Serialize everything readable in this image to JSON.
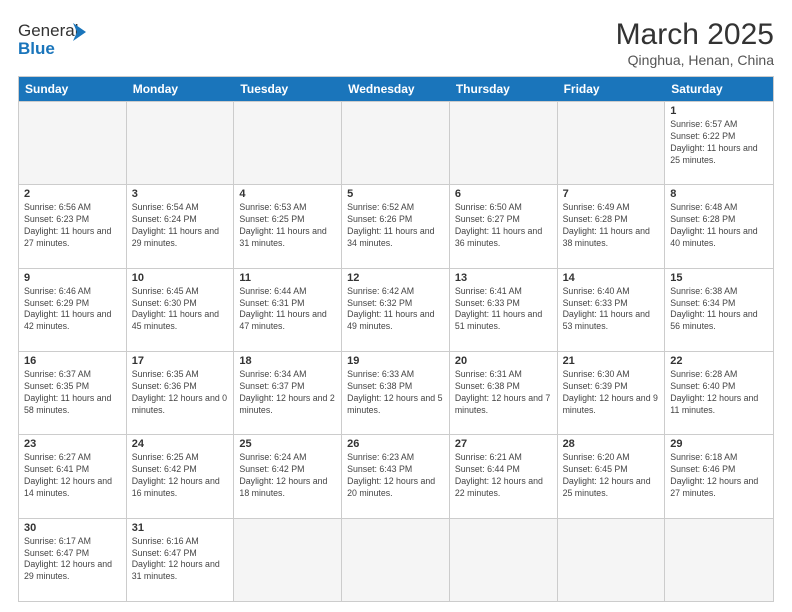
{
  "logo": {
    "text_general": "General",
    "text_blue": "Blue"
  },
  "title": {
    "month_year": "March 2025",
    "location": "Qinghua, Henan, China"
  },
  "header_days": [
    "Sunday",
    "Monday",
    "Tuesday",
    "Wednesday",
    "Thursday",
    "Friday",
    "Saturday"
  ],
  "weeks": [
    [
      {
        "day": "",
        "info": ""
      },
      {
        "day": "",
        "info": ""
      },
      {
        "day": "",
        "info": ""
      },
      {
        "day": "",
        "info": ""
      },
      {
        "day": "",
        "info": ""
      },
      {
        "day": "",
        "info": ""
      },
      {
        "day": "1",
        "info": "Sunrise: 6:57 AM\nSunset: 6:22 PM\nDaylight: 11 hours and 25 minutes."
      }
    ],
    [
      {
        "day": "2",
        "info": "Sunrise: 6:56 AM\nSunset: 6:23 PM\nDaylight: 11 hours and 27 minutes."
      },
      {
        "day": "3",
        "info": "Sunrise: 6:54 AM\nSunset: 6:24 PM\nDaylight: 11 hours and 29 minutes."
      },
      {
        "day": "4",
        "info": "Sunrise: 6:53 AM\nSunset: 6:25 PM\nDaylight: 11 hours and 31 minutes."
      },
      {
        "day": "5",
        "info": "Sunrise: 6:52 AM\nSunset: 6:26 PM\nDaylight: 11 hours and 34 minutes."
      },
      {
        "day": "6",
        "info": "Sunrise: 6:50 AM\nSunset: 6:27 PM\nDaylight: 11 hours and 36 minutes."
      },
      {
        "day": "7",
        "info": "Sunrise: 6:49 AM\nSunset: 6:28 PM\nDaylight: 11 hours and 38 minutes."
      },
      {
        "day": "8",
        "info": "Sunrise: 6:48 AM\nSunset: 6:28 PM\nDaylight: 11 hours and 40 minutes."
      }
    ],
    [
      {
        "day": "9",
        "info": "Sunrise: 6:46 AM\nSunset: 6:29 PM\nDaylight: 11 hours and 42 minutes."
      },
      {
        "day": "10",
        "info": "Sunrise: 6:45 AM\nSunset: 6:30 PM\nDaylight: 11 hours and 45 minutes."
      },
      {
        "day": "11",
        "info": "Sunrise: 6:44 AM\nSunset: 6:31 PM\nDaylight: 11 hours and 47 minutes."
      },
      {
        "day": "12",
        "info": "Sunrise: 6:42 AM\nSunset: 6:32 PM\nDaylight: 11 hours and 49 minutes."
      },
      {
        "day": "13",
        "info": "Sunrise: 6:41 AM\nSunset: 6:33 PM\nDaylight: 11 hours and 51 minutes."
      },
      {
        "day": "14",
        "info": "Sunrise: 6:40 AM\nSunset: 6:33 PM\nDaylight: 11 hours and 53 minutes."
      },
      {
        "day": "15",
        "info": "Sunrise: 6:38 AM\nSunset: 6:34 PM\nDaylight: 11 hours and 56 minutes."
      }
    ],
    [
      {
        "day": "16",
        "info": "Sunrise: 6:37 AM\nSunset: 6:35 PM\nDaylight: 11 hours and 58 minutes."
      },
      {
        "day": "17",
        "info": "Sunrise: 6:35 AM\nSunset: 6:36 PM\nDaylight: 12 hours and 0 minutes."
      },
      {
        "day": "18",
        "info": "Sunrise: 6:34 AM\nSunset: 6:37 PM\nDaylight: 12 hours and 2 minutes."
      },
      {
        "day": "19",
        "info": "Sunrise: 6:33 AM\nSunset: 6:38 PM\nDaylight: 12 hours and 5 minutes."
      },
      {
        "day": "20",
        "info": "Sunrise: 6:31 AM\nSunset: 6:38 PM\nDaylight: 12 hours and 7 minutes."
      },
      {
        "day": "21",
        "info": "Sunrise: 6:30 AM\nSunset: 6:39 PM\nDaylight: 12 hours and 9 minutes."
      },
      {
        "day": "22",
        "info": "Sunrise: 6:28 AM\nSunset: 6:40 PM\nDaylight: 12 hours and 11 minutes."
      }
    ],
    [
      {
        "day": "23",
        "info": "Sunrise: 6:27 AM\nSunset: 6:41 PM\nDaylight: 12 hours and 14 minutes."
      },
      {
        "day": "24",
        "info": "Sunrise: 6:25 AM\nSunset: 6:42 PM\nDaylight: 12 hours and 16 minutes."
      },
      {
        "day": "25",
        "info": "Sunrise: 6:24 AM\nSunset: 6:42 PM\nDaylight: 12 hours and 18 minutes."
      },
      {
        "day": "26",
        "info": "Sunrise: 6:23 AM\nSunset: 6:43 PM\nDaylight: 12 hours and 20 minutes."
      },
      {
        "day": "27",
        "info": "Sunrise: 6:21 AM\nSunset: 6:44 PM\nDaylight: 12 hours and 22 minutes."
      },
      {
        "day": "28",
        "info": "Sunrise: 6:20 AM\nSunset: 6:45 PM\nDaylight: 12 hours and 25 minutes."
      },
      {
        "day": "29",
        "info": "Sunrise: 6:18 AM\nSunset: 6:46 PM\nDaylight: 12 hours and 27 minutes."
      }
    ],
    [
      {
        "day": "30",
        "info": "Sunrise: 6:17 AM\nSunset: 6:47 PM\nDaylight: 12 hours and 29 minutes."
      },
      {
        "day": "31",
        "info": "Sunrise: 6:16 AM\nSunset: 6:47 PM\nDaylight: 12 hours and 31 minutes."
      },
      {
        "day": "",
        "info": ""
      },
      {
        "day": "",
        "info": ""
      },
      {
        "day": "",
        "info": ""
      },
      {
        "day": "",
        "info": ""
      },
      {
        "day": "",
        "info": ""
      }
    ]
  ]
}
